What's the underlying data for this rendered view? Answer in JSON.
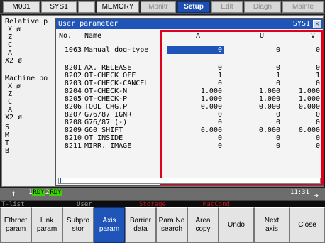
{
  "topbar": {
    "tabs": [
      {
        "label": "M001",
        "state": "normal"
      },
      {
        "label": "SYS1",
        "state": "normal"
      },
      {
        "label": "",
        "state": "normal"
      },
      {
        "label": "MEMORY",
        "state": "normal"
      },
      {
        "label": "Monitr",
        "state": "dim"
      },
      {
        "label": "Setup",
        "state": "active"
      },
      {
        "label": "Edit",
        "state": "dim"
      },
      {
        "label": "Diagn",
        "state": "dim"
      },
      {
        "label": "Mainte",
        "state": "dim"
      }
    ]
  },
  "background": {
    "lines": [
      "Relative p",
      "X ø",
      "Z",
      "C",
      "A",
      "X2 ø",
      "Machine po",
      "X ø",
      "Z",
      "C",
      "A",
      "X2 ø",
      "S",
      "M",
      "T",
      "B"
    ]
  },
  "dialog": {
    "title": "User parameter",
    "system": "SYS1",
    "close_label": "✕",
    "columns": {
      "no": "No.",
      "name": "Name",
      "a": "A",
      "u": "U",
      "v": "V"
    },
    "rows": [
      {
        "no": "1063",
        "name": "Manual dog-type",
        "a": "0",
        "u": "0",
        "v": "0"
      },
      {
        "no": "",
        "name": "",
        "a": "",
        "u": "",
        "v": ""
      },
      {
        "no": "8201",
        "name": "AX. RELEASE",
        "a": "0",
        "u": "0",
        "v": "0"
      },
      {
        "no": "8202",
        "name": "OT-CHECK OFF",
        "a": "1",
        "u": "1",
        "v": "1"
      },
      {
        "no": "8203",
        "name": "OT-CHECK-CANCEL",
        "a": "0",
        "u": "0",
        "v": "0"
      },
      {
        "no": "8204",
        "name": "OT-CHECK-N",
        "a": "1.000",
        "u": "1.000",
        "v": "1.000"
      },
      {
        "no": "8205",
        "name": "OT-CHECK-P",
        "a": "1.000",
        "u": "1.000",
        "v": "1.000"
      },
      {
        "no": "8206",
        "name": "TOOL CHG.P",
        "a": "0.000",
        "u": "0.000",
        "v": "0.000"
      },
      {
        "no": "8207",
        "name": "G76/87 IGNR",
        "a": "0",
        "u": "0",
        "v": "0"
      },
      {
        "no": "8208",
        "name": "G76/87 (-)",
        "a": "0",
        "u": "0",
        "v": "0"
      },
      {
        "no": "8209",
        "name": "G60 SHIFT",
        "a": "0.000",
        "u": "0.000",
        "v": "0.000"
      },
      {
        "no": "8210",
        "name": "OT INSIDE",
        "a": "0",
        "u": "0",
        "v": "0"
      },
      {
        "no": "8211",
        "name": "MIRR. IMAGE",
        "a": "0",
        "u": "0",
        "v": "0"
      }
    ],
    "input_value": ""
  },
  "status": {
    "rdy1_num": "1",
    "rdy1_text": "RDY",
    "rdy2_num": "2",
    "rdy2_text": "RDY",
    "time": "11:31"
  },
  "categories": [
    {
      "label": "T-list",
      "color": "gray"
    },
    {
      "label": "User",
      "color": "gray"
    },
    {
      "label": "Storage",
      "color": "red"
    },
    {
      "label": "MacCond",
      "color": "red"
    }
  ],
  "softkeys": [
    {
      "line1": "Ethrnet",
      "line2": "param",
      "active": false
    },
    {
      "line1": "Link",
      "line2": "param",
      "active": false
    },
    {
      "line1": "Subpro",
      "line2": "stor",
      "active": false
    },
    {
      "line1": "Axis",
      "line2": "param",
      "active": true
    },
    {
      "line1": "Barrier",
      "line2": "data",
      "active": false
    },
    {
      "line1": "Para No",
      "line2": "search",
      "active": false
    },
    {
      "line1": "Area",
      "line2": "copy",
      "active": false
    },
    {
      "line1": "Undo",
      "line2": "",
      "active": false
    },
    {
      "line1": "Next",
      "line2": "axis",
      "active": false
    },
    {
      "line1": "Close",
      "line2": "",
      "active": false
    }
  ],
  "colors": {
    "accent": "#1f54b8",
    "highlight": "#e0001a",
    "ready": "#39d400"
  }
}
